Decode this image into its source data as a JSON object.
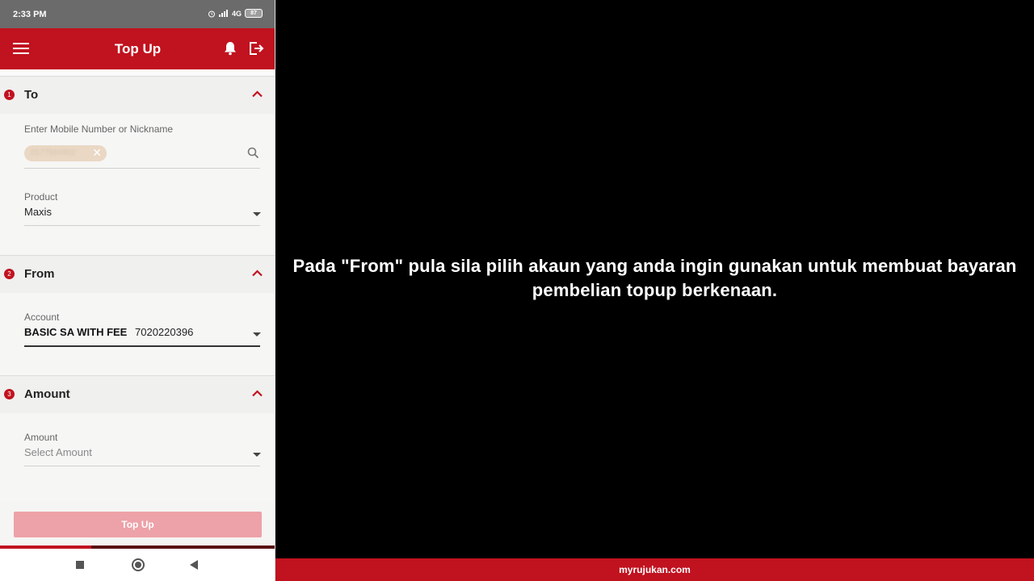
{
  "status_bar": {
    "time": "2:33 PM",
    "network": "4G",
    "battery": "87"
  },
  "app_bar": {
    "title": "Top Up"
  },
  "sections": {
    "to": {
      "number": "1",
      "label": "To",
      "mobile_label": "Enter Mobile Number or Nickname",
      "chip_value": "0177584902",
      "product_label": "Product",
      "product_value": "Maxis"
    },
    "from": {
      "number": "2",
      "label": "From",
      "account_label": "Account",
      "account_name": "BASIC SA WITH FEE",
      "account_number": "7020220396"
    },
    "amount": {
      "number": "3",
      "label": "Amount",
      "amount_label": "Amount",
      "amount_placeholder": "Select Amount"
    }
  },
  "topup_button": {
    "label": "Top Up"
  },
  "caption": {
    "text": "Pada \"From\" pula sila pilih akaun yang anda ingin gunakan untuk membuat bayaran pembelian topup berkenaan."
  },
  "footer": {
    "text": "myrujukan.com"
  },
  "colors": {
    "brand_red": "#c1121f",
    "button_disabled": "#eda1a8"
  }
}
